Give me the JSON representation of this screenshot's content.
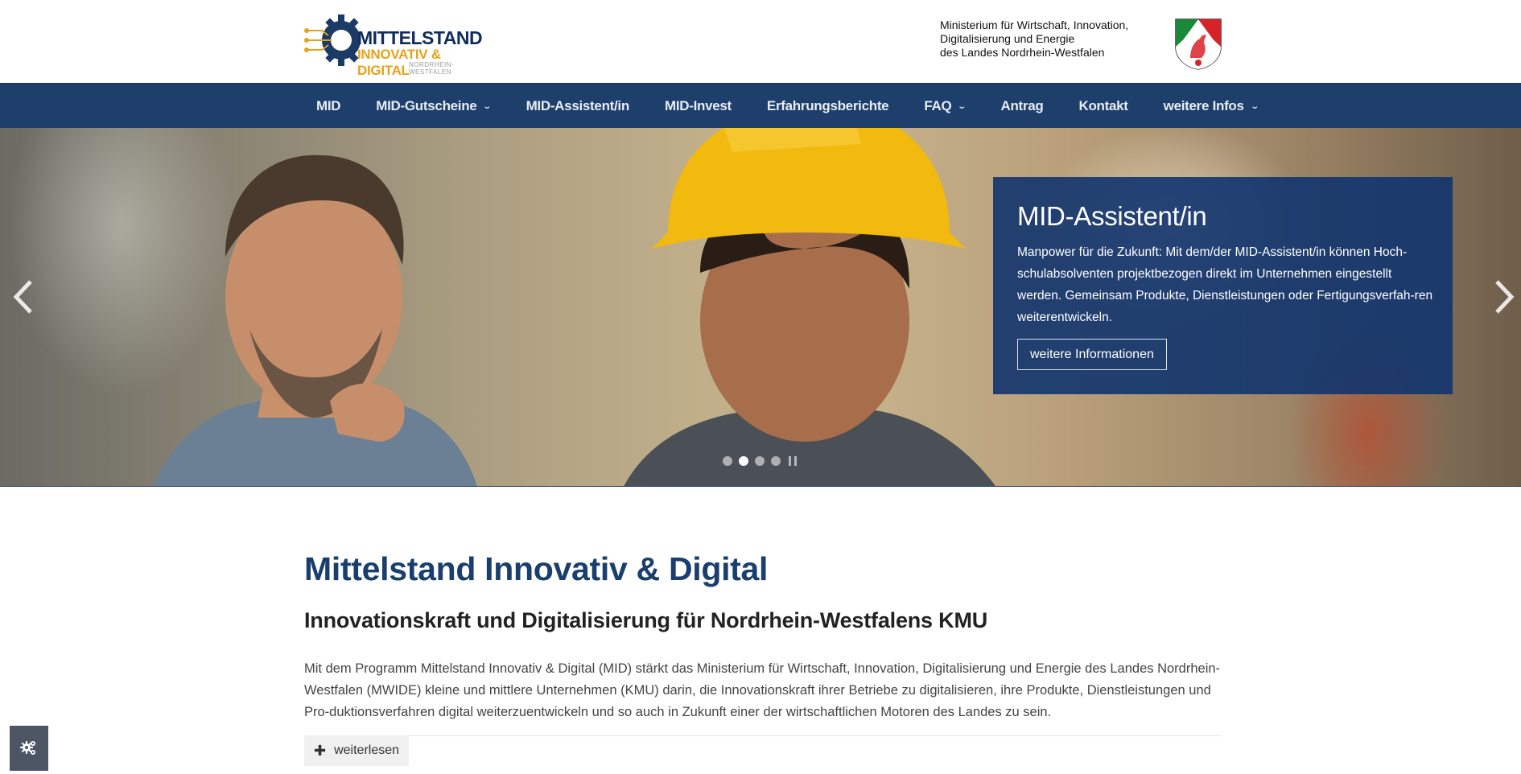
{
  "header": {
    "logo": {
      "title": "MITTELSTAND",
      "subtitle": "INNOVATIV & DIGITAL",
      "region": "NORDRHEIN-WESTFALEN"
    },
    "ministry": {
      "line1": "Ministerium für Wirtschaft, Innovation,",
      "line2": "Digitalisierung und Energie",
      "line3": "des Landes Nordrhein-Westfalen"
    }
  },
  "nav": {
    "items": [
      {
        "label": "MID",
        "dropdown": false
      },
      {
        "label": "MID-Gutscheine",
        "dropdown": true
      },
      {
        "label": "MID-Assistent/in",
        "dropdown": false
      },
      {
        "label": "MID-Invest",
        "dropdown": false
      },
      {
        "label": "Erfahrungsberichte",
        "dropdown": false
      },
      {
        "label": "FAQ",
        "dropdown": true
      },
      {
        "label": "Antrag",
        "dropdown": false
      },
      {
        "label": "Kontakt",
        "dropdown": false
      },
      {
        "label": "weitere Infos",
        "dropdown": true
      }
    ]
  },
  "hero": {
    "title": "MID-Assistent/in",
    "text": "Manpower für die Zukunft: Mit dem/der MID-Assistent/in können Hoch-schulabsolventen projektbezogen direkt im Unternehmen eingestellt werden. Gemeinsam Produkte, Dienstleistungen oder Fertigungsverfah-ren weiterentwickeln.",
    "button": "weitere Informationen",
    "slides_total": 4,
    "active_slide": 2
  },
  "content": {
    "title": "Mittelstand Innovativ & Digital",
    "subtitle": "Innovationskraft und Digitalisierung für Nordrhein-Westfalens KMU",
    "intro": "Mit dem Programm Mittelstand Innovativ & Digital (MID) stärkt das Ministerium für Wirtschaft, Innovation, Digitalisierung und Energie des Landes Nordrhein-Westfalen (MWIDE) kleine und mittlere Unternehmen (KMU) darin, die Innovationskraft ihrer Betriebe zu digitalisieren, ihre Produkte, Dienstleistungen und Pro-duktionsverfahren digital weiterzuentwickeln und so auch in Zukunft einer der wirtschaftlichen Motoren des Landes zu sein.",
    "readmore": "weiterlesen"
  },
  "colors": {
    "nav_bg": "#1e3e6b",
    "accent_gold": "#e6a21a",
    "title_blue": "#1a3f6f",
    "caption_bg": "#11346e"
  },
  "icons": {
    "settings": "cogs-icon",
    "prev": "chevron-left-icon",
    "next": "chevron-right-icon"
  }
}
